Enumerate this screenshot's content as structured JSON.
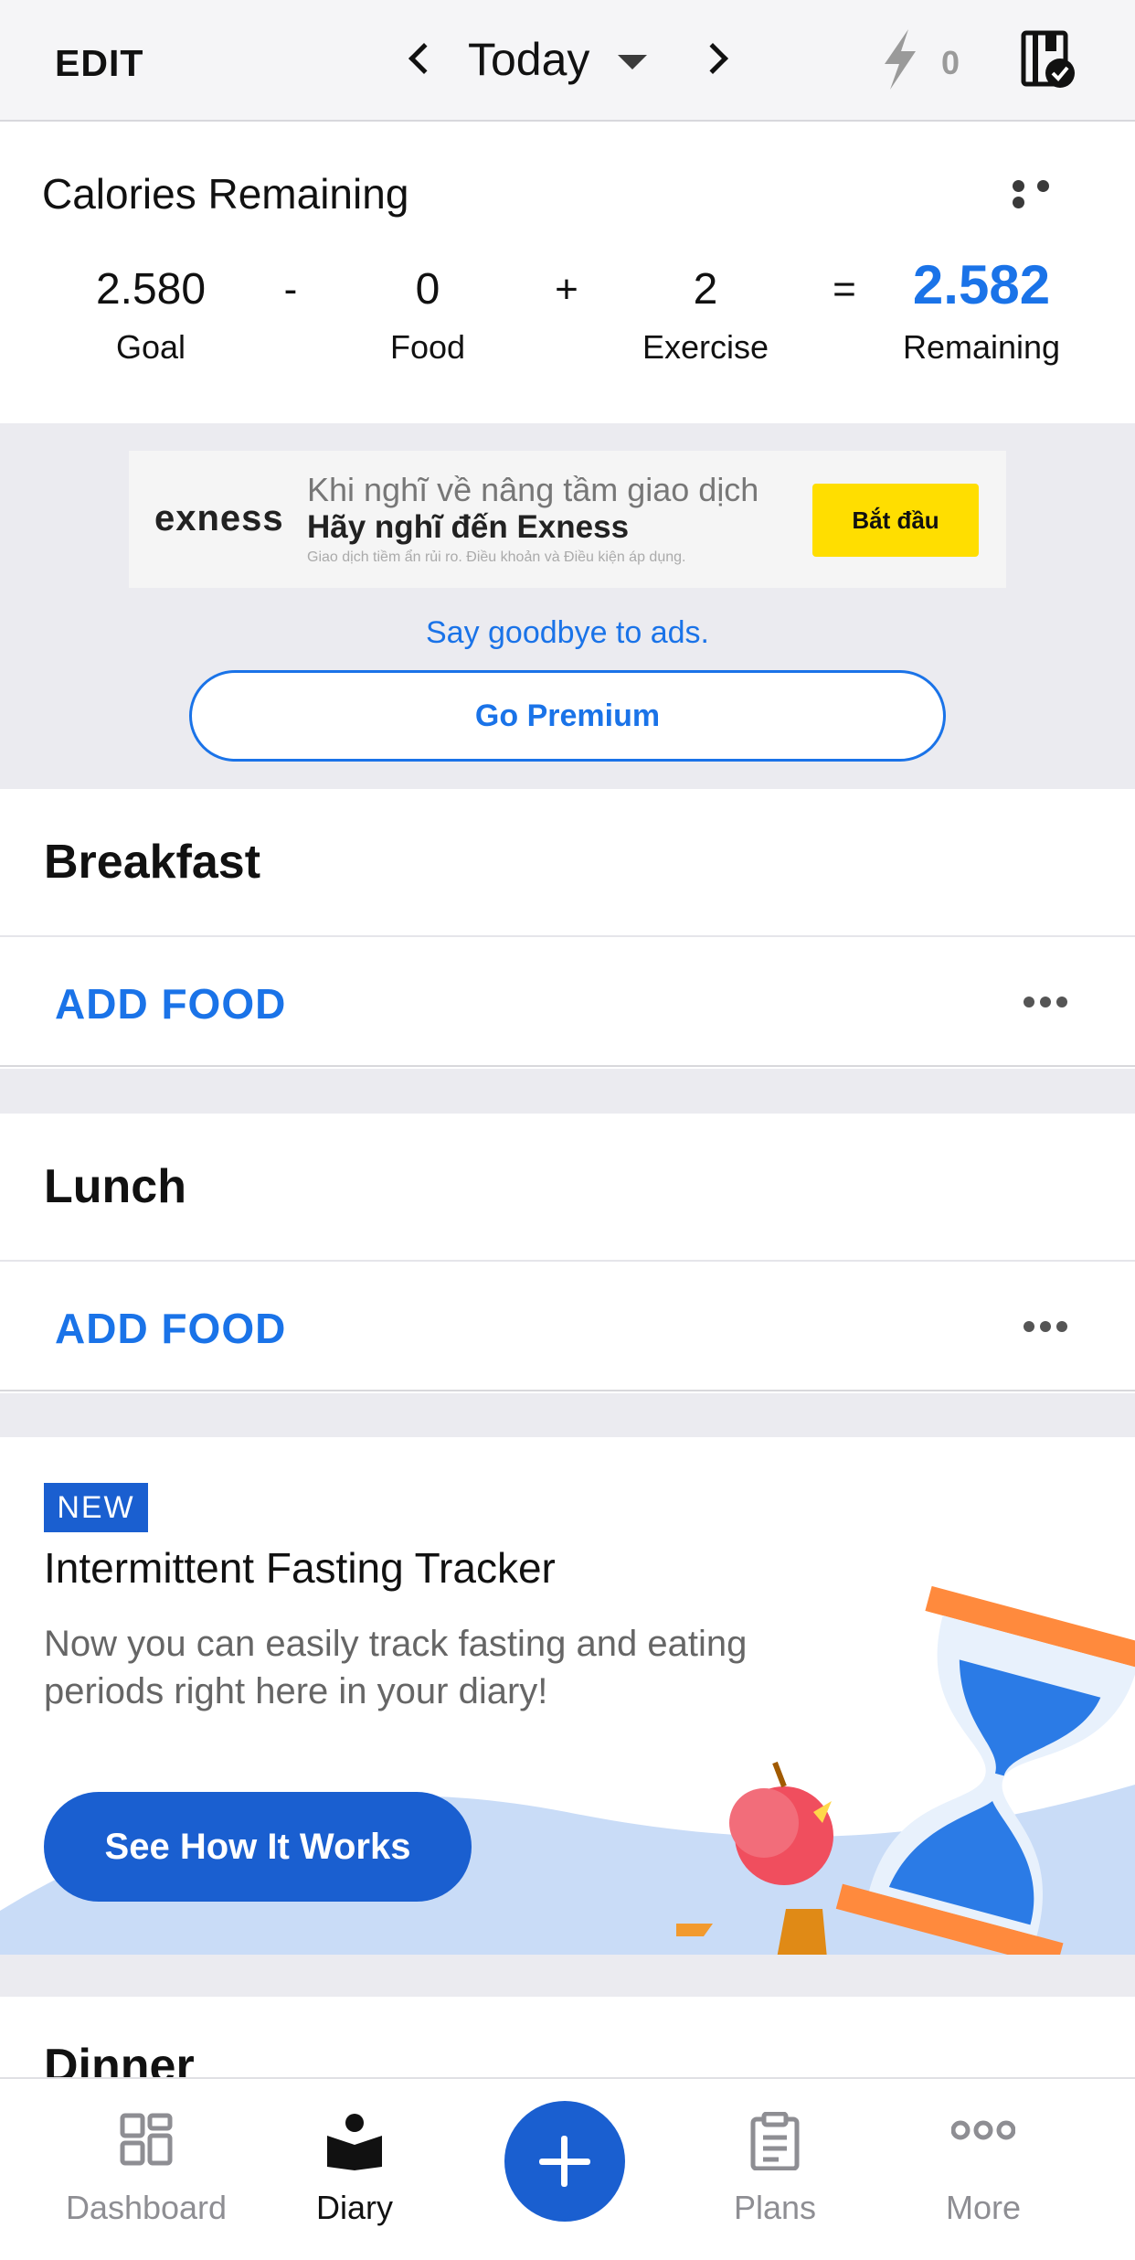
{
  "header": {
    "edit_label": "EDIT",
    "date_label": "Today",
    "streak_count": "0",
    "icons": [
      "chevron-left-icon",
      "caret-down-icon",
      "chevron-right-icon",
      "lightning-icon",
      "journal-check-icon"
    ]
  },
  "calories": {
    "title": "Calories Remaining",
    "goal_value": "2.580",
    "goal_label": "Goal",
    "op_minus": "-",
    "food_value": "0",
    "food_label": "Food",
    "op_plus": "+",
    "exercise_value": "2",
    "exercise_label": "Exercise",
    "op_equals": "=",
    "remaining_value": "2.582",
    "remaining_label": "Remaining"
  },
  "ad": {
    "brand": "exness",
    "line1": "Khi nghĩ về nâng tầm giao dịch",
    "line2": "Hãy nghĩ đến Exness",
    "line3": "Giao dịch tiềm ẩn rủi ro. Điều khoản và Điều kiện áp dụng.",
    "cta": "Bắt đầu",
    "goodbye_text": "Say goodbye to ads.",
    "premium_button": "Go Premium"
  },
  "meals": {
    "breakfast_title": "Breakfast",
    "breakfast_add": "ADD FOOD",
    "lunch_title": "Lunch",
    "lunch_add": "ADD FOOD",
    "dinner_title": "Dinner"
  },
  "promo": {
    "badge": "NEW",
    "title": "Intermittent Fasting Tracker",
    "description": "Now you can easily track fasting and eating periods right here in your diary!",
    "button": "See How It Works"
  },
  "tabbar": {
    "dashboard": "Dashboard",
    "diary": "Diary",
    "plans": "Plans",
    "more": "More",
    "active": "Diary"
  },
  "colors": {
    "accent": "#1a73e8",
    "brand_blue": "#1a5fd0",
    "ad_cta": "#ffde00",
    "section_bg": "#ebebf0"
  }
}
